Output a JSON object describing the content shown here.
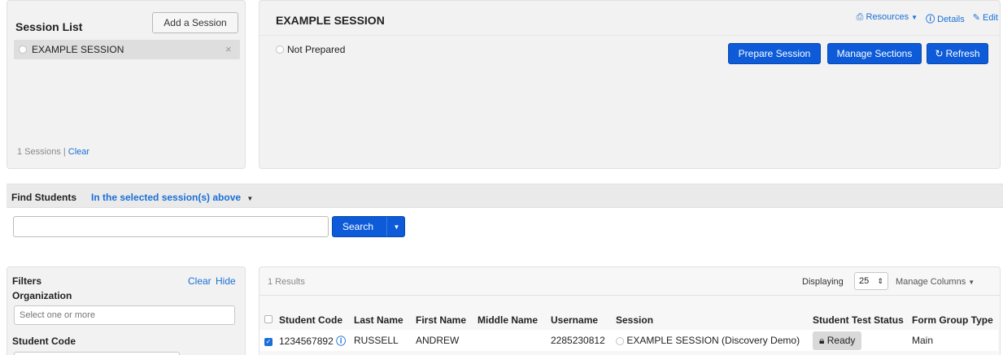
{
  "session_list": {
    "title": "Session List",
    "add_button": "Add a Session",
    "items": [
      {
        "label": "EXAMPLE SESSION",
        "remove": "×"
      }
    ],
    "count_text": "1 Sessions",
    "separator": "|",
    "clear": "Clear"
  },
  "session_detail": {
    "title": "EXAMPLE SESSION",
    "resources": "Resources",
    "details": "Details",
    "edit": "Edit",
    "status": "Not Prepared",
    "prepare": "Prepare Session",
    "manage_sections": "Manage Sections",
    "refresh": "Refresh"
  },
  "find_students": {
    "label": "Find Students",
    "scope": "In the selected session(s) above",
    "search_value": "",
    "search_button": "Search"
  },
  "filters": {
    "title": "Filters",
    "clear": "Clear",
    "hide": "Hide",
    "organization_label": "Organization",
    "organization_placeholder": "Select one or more",
    "student_code_label": "Student Code"
  },
  "results": {
    "count_text": "1 Results",
    "displaying_label": "Displaying",
    "page_size": "25",
    "manage_columns": "Manage Columns",
    "columns": [
      "Student Code",
      "Last Name",
      "First Name",
      "Middle Name",
      "Username",
      "Session",
      "Student Test Status",
      "Form Group Type"
    ],
    "rows": [
      {
        "student_code": "1234567892",
        "last_name": "RUSSELL",
        "first_name": "ANDREW",
        "middle_name": "",
        "username": "2285230812",
        "session": "EXAMPLE SESSION (Discovery Demo)",
        "status": "Ready",
        "form_group_type": "Main"
      }
    ]
  },
  "colors": {
    "primary": "#0d5bd8",
    "link": "#1a6fd6",
    "panel": "#f2f2f2"
  }
}
